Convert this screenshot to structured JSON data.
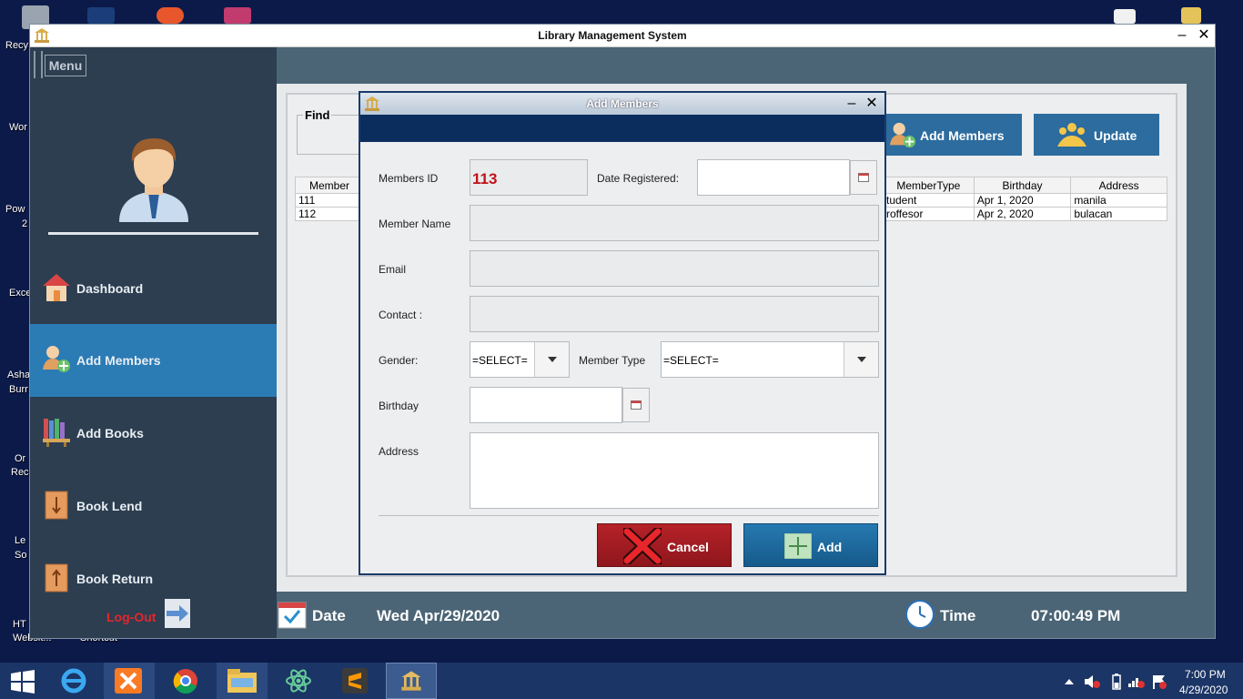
{
  "desktop": {
    "labels": [
      "Recy",
      "Wor",
      "Pow",
      "2",
      "Exce",
      "Asha",
      "Burr",
      "Or",
      "Rec",
      "Le",
      "So",
      "HT",
      "Websit...",
      "Shortcut"
    ]
  },
  "window": {
    "title": "Library Management System",
    "minimize": "–",
    "close": "✕"
  },
  "sidebar": {
    "menu_label": "Menu",
    "items": [
      {
        "label": "Dashboard",
        "icon": "house-icon"
      },
      {
        "label": "Add Members",
        "icon": "add-member-icon"
      },
      {
        "label": "Add Books",
        "icon": "books-icon"
      },
      {
        "label": "Book Lend",
        "icon": "book-lend-icon"
      },
      {
        "label": "Book Return",
        "icon": "book-return-icon"
      }
    ],
    "logout_label": "Log-Out"
  },
  "main": {
    "find_label": "Find",
    "add_members_btn": "Add Members",
    "update_btn": "Update",
    "table": {
      "left_header": "Member",
      "left_rows": [
        "111",
        "112"
      ],
      "right_headers": [
        "MemberType",
        "Birthday",
        "Address"
      ],
      "right_rows": [
        [
          "tudent",
          "Apr 1, 2020",
          "manila"
        ],
        [
          "roffesor",
          "Apr 2, 2020",
          "bulacan"
        ]
      ]
    }
  },
  "footer": {
    "date_label": "Date",
    "date_value": "Wed Apr/29/2020",
    "time_label": "Time",
    "time_value": "07:00:49 PM"
  },
  "dialog": {
    "title": "Add Members",
    "minimize": "–",
    "close": "✕",
    "members_id_label": "Members ID",
    "members_id_value": "113",
    "date_registered_label": "Date Registered:",
    "member_name_label": "Member Name",
    "email_label": "Email",
    "contact_label": "Contact :",
    "gender_label": "Gender:",
    "gender_value": "=SELECT=",
    "member_type_label": "Member Type",
    "member_type_value": "=SELECT=",
    "birthday_label": "Birthday",
    "address_label": "Address",
    "cancel_label": "Cancel",
    "add_label": "Add"
  },
  "taskbar": {
    "time": "7:00 PM",
    "date": "4/29/2020"
  },
  "colors": {
    "sidebar_bg": "#2c3e50",
    "active_nav": "#2b7bb5",
    "dialog_band": "#0b2d5e",
    "cancel_red": "#a11d22",
    "add_blue": "#1e6a9e",
    "member_id_red": "#c0121a"
  }
}
